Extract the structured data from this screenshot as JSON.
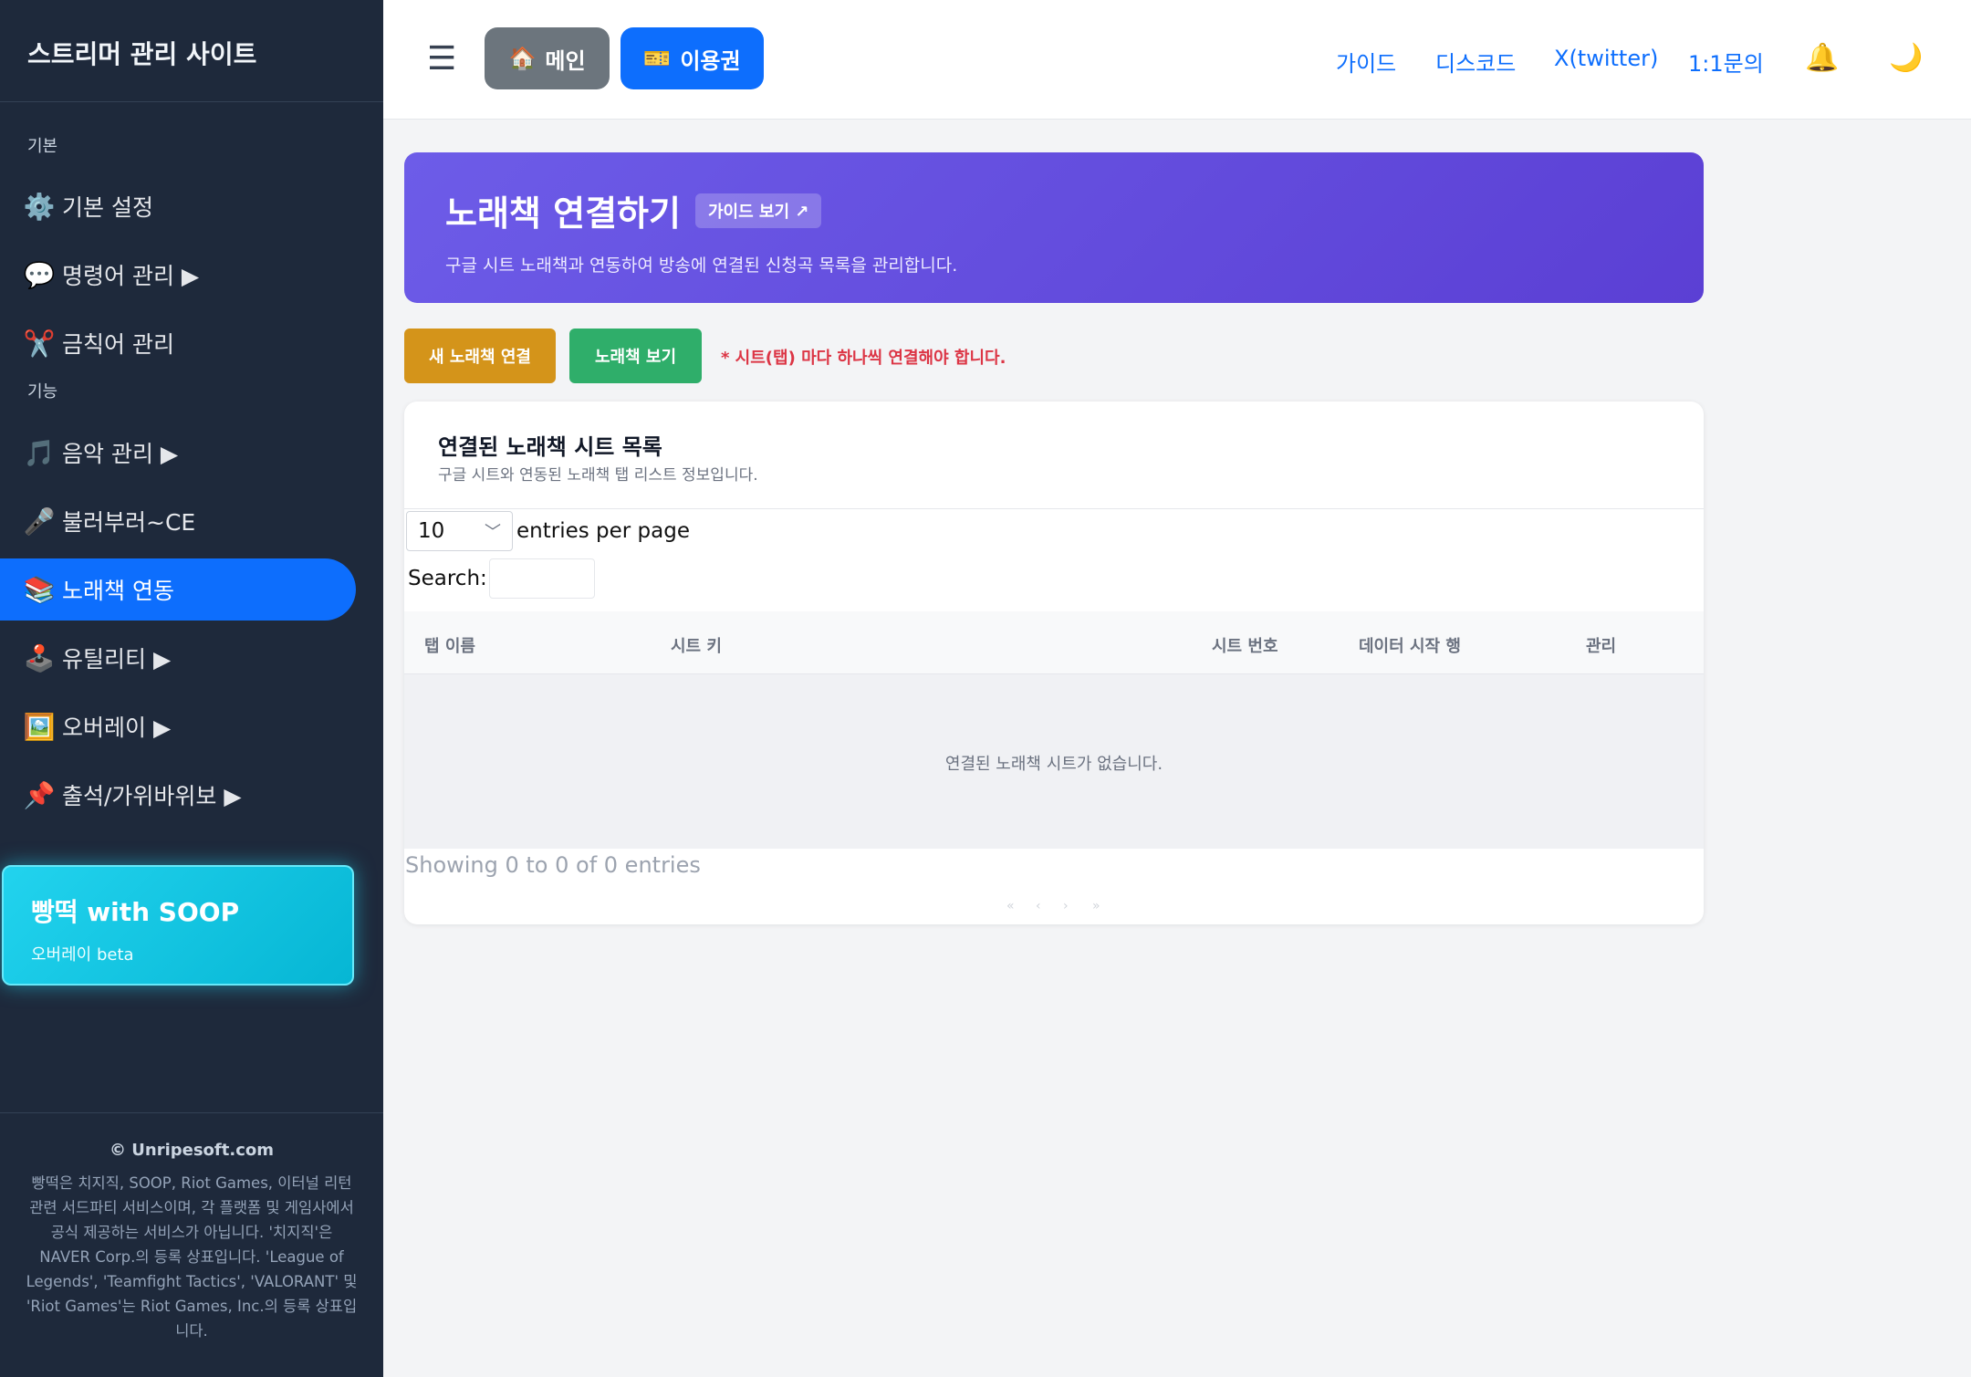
{
  "sidebar": {
    "brand": "스트리머 관리 사이트",
    "section_basic": "기본",
    "section_features": "기능",
    "items": [
      {
        "icon": "⚙️",
        "label": "기본 설정"
      },
      {
        "icon": "💬",
        "label": "명령어 관리 ▶"
      },
      {
        "icon": "✂️",
        "label": "금칙어 관리"
      },
      {
        "icon": "🎵",
        "label": "음악 관리 ▶"
      },
      {
        "icon": "🎤",
        "label": "불러부러~CE"
      },
      {
        "icon": "📚",
        "label": "노래책 연동"
      },
      {
        "icon": "🕹️",
        "label": "유틸리티 ▶"
      },
      {
        "icon": "🖼️",
        "label": "오버레이 ▶"
      },
      {
        "icon": "📌",
        "label": "출석/가위바위보 ▶"
      }
    ],
    "active_item": "노래책 연동",
    "promo": {
      "title": "빵떡 with SOOP",
      "subtitle": "오버레이 beta"
    },
    "footer": {
      "copyright": "© Unripesoft.com",
      "legal": "빵떡은 치지직, SOOP, Riot Games, 이터널 리턴 관련 서드파티 서비스이며, 각 플랫폼 및 게임사에서 공식 제공하는 서비스가 아닙니다. '치지직'은 NAVER Corp.의 등록 상표입니다. 'League of Legends', 'Teamfight Tactics', 'VALORANT' 및 'Riot Games'는 Riot Games, Inc.의 등록 상표입니다."
    }
  },
  "topbar": {
    "menu_icon": "☰",
    "main_button": {
      "icon": "🏠",
      "label": "메인"
    },
    "ticket_button": {
      "icon": "🎫",
      "label": "이용권"
    },
    "links": [
      "가이드",
      "디스코드",
      "X(twitter)",
      "1:1문의"
    ],
    "bell_icon": "🔔",
    "theme_icon": "🌙"
  },
  "hero": {
    "title": "노래책 연결하기",
    "guide_label": "가이드 보기 ↗",
    "description": "구글 시트 노래책과 연동하여 방송에 연결된 신청곡 목록을 관리합니다."
  },
  "actions": {
    "new_label": "새 노래책 연결",
    "view_label": "노래책 보기",
    "warning": "* 시트(탭) 마다 하나씩 연결해야 합니다."
  },
  "table_card": {
    "title": "연결된 노래책 시트 목록",
    "subtitle": "구글 시트와 연동된 노래책 탭 리스트 정보입니다.",
    "page_size": "10",
    "entries_label": "entries per page",
    "search_label": "Search:",
    "columns": [
      "탭 이름",
      "시트 키",
      "시트 번호",
      "데이터 시작 행",
      "관리"
    ],
    "empty_message": "연결된 노래책 시트가 없습니다.",
    "showing": "Showing 0 to 0 of 0 entries",
    "pager": [
      "«",
      "‹",
      "›",
      "»"
    ]
  },
  "colors": {
    "sidebar_bg": "#1e293b",
    "accent": "#0d6efd",
    "hero_gradient": [
      "#6d5ce8",
      "#5b3fd4"
    ],
    "new_button": "#d4941a",
    "view_button": "#2fae6a",
    "warning": "#dc3545",
    "promo": "#22d3ee"
  }
}
